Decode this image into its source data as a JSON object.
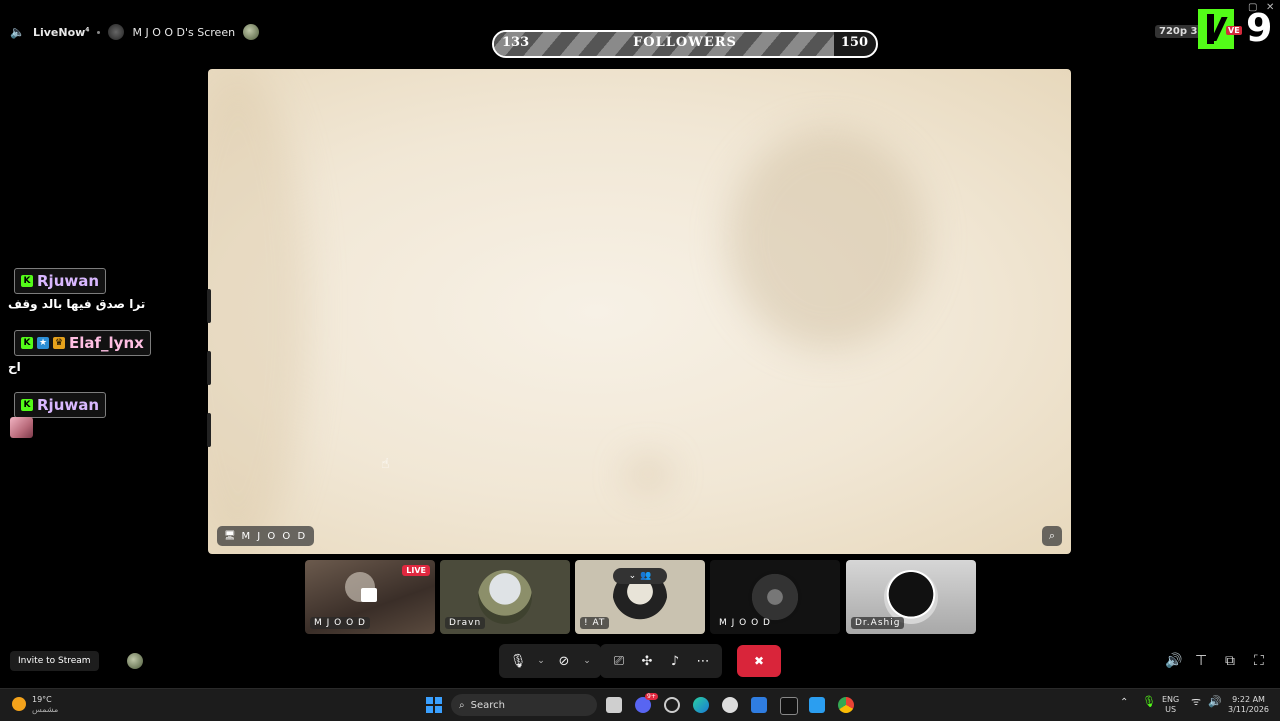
{
  "topbar": {
    "channel": "LiveNow",
    "channel_superscript": "4",
    "screen_title": "M J O O D's Screen"
  },
  "followers": {
    "current": "133",
    "label": "FOLLOWERS",
    "goal": "150",
    "progress_fraction": 0.89
  },
  "stream_badge": {
    "quality": "720p 30F",
    "live_fragment": "VE",
    "number": "9",
    "brand_color": "#53fc18"
  },
  "stage": {
    "presenter_label": "M J O O D"
  },
  "chat": [
    {
      "user": "Rjuwan",
      "message": "ترا صدق فيها بالد وقف",
      "badges": [
        "kick"
      ]
    },
    {
      "user": "Elaf_lynx",
      "message": "اح",
      "badges": [
        "kick",
        "blue-star",
        "gold-crown"
      ]
    },
    {
      "user": "Rjuwan",
      "message": "",
      "badges": [
        "kick"
      ]
    }
  ],
  "thumbnails": [
    {
      "label": "M J O O D",
      "live": "LIVE"
    },
    {
      "label": "Dravn"
    },
    {
      "label": "! AT"
    },
    {
      "label": "M J O O D"
    },
    {
      "label": "Dr.Ashig"
    }
  ],
  "bottom": {
    "invite_label": "Invite to Stream"
  },
  "taskbar": {
    "weather_temp": "19°C",
    "weather_desc": "مشمس",
    "search_label": "Search",
    "discord_badge": "9+",
    "lang": "ENG",
    "region": "US",
    "time": "9:22 AM",
    "date": "3/11/2026"
  },
  "colors": {
    "live_red": "#e0283f",
    "end_call": "#d9253a",
    "accent_green": "#53fc18"
  }
}
